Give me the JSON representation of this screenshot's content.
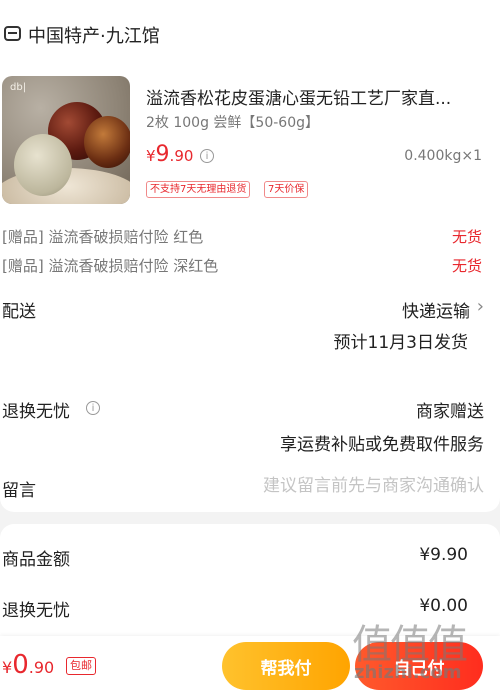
{
  "shop": {
    "name": "中国特产·九江馆",
    "icon": "store-icon"
  },
  "product": {
    "title": "溢流香松花皮蛋溏心蛋无铅工艺厂家直...",
    "spec": "2枚 100g 尝鲜【50-60g】",
    "price": {
      "symbol": "¥",
      "integer": "9",
      "decimal": ".90"
    },
    "quantity": "0.400kg×1",
    "tags": [
      "不支持7天无理由退货",
      "7天价保"
    ],
    "image_logo": "db|"
  },
  "gifts": [
    {
      "label": "[赠品] 溢流香破损赔付险 红色",
      "status": "无货"
    },
    {
      "label": "[赠品] 溢流香破损赔付险 深红色",
      "status": "无货"
    }
  ],
  "shipping": {
    "label": "配送",
    "method": "快递运输",
    "chevron": "›",
    "date": "预计11月3日发货"
  },
  "returns": {
    "label": "退换无忧",
    "info_icon": "i",
    "value": "商家赠送",
    "desc": "享运费补贴或免费取件服务"
  },
  "message": {
    "label": "留言",
    "placeholder": "建议留言前先与商家沟通确认"
  },
  "summary": [
    {
      "label": "商品金额",
      "value": "¥9.90"
    },
    {
      "label": "退换无忧",
      "value": "¥0.00"
    }
  ],
  "bottom": {
    "total": {
      "symbol": "¥",
      "integer": "0",
      "decimal": ".90"
    },
    "free_shipping": "包邮",
    "friend_pay": "帮我付",
    "self_pay": "自己付"
  },
  "watermark": {
    "glyphs": "值值值",
    "domain": "zhizhi.com"
  },
  "colors": {
    "accent_red": "#e8282e",
    "button_yellow": "#ffb000",
    "button_red": "#ff3a24",
    "muted_gray": "#777777"
  }
}
